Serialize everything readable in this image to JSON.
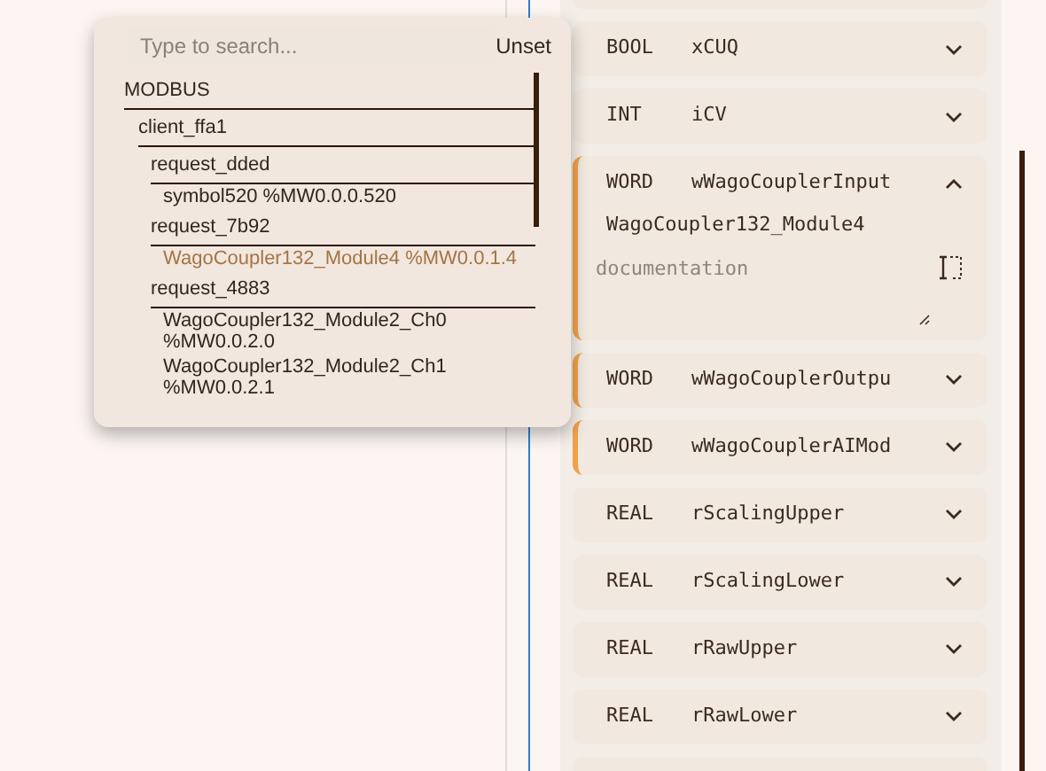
{
  "picker": {
    "search": {
      "placeholder": "Type to search..."
    },
    "unset_button": "Unset",
    "tree": [
      {
        "label": "MODBUS",
        "children": [
          {
            "label": "client_ffa1",
            "children": [
              {
                "label": "request_dded",
                "children": [
                  {
                    "label": "symbol520 %MW0.0.0.520",
                    "selected": false
                  }
                ]
              },
              {
                "label": "request_7b92",
                "children": [
                  {
                    "label": "WagoCoupler132_Module4 %MW0.0.1.4",
                    "selected": true
                  }
                ]
              },
              {
                "label": "request_4883",
                "children": [
                  {
                    "label": "WagoCoupler132_Module2_Ch0 %MW0.0.2.0",
                    "selected": false
                  },
                  {
                    "label": "WagoCoupler132_Module2_Ch1 %MW0.0.2.1",
                    "selected": false
                  }
                ]
              }
            ]
          }
        ]
      }
    ]
  },
  "variables": [
    {
      "type": "BOOL",
      "name": "xCUQ",
      "linked": false,
      "expanded": false
    },
    {
      "type": "INT",
      "name": "iCV",
      "linked": false,
      "expanded": false
    },
    {
      "type": "WORD",
      "name": "wWagoCouplerInput",
      "linked": true,
      "expanded": true,
      "mapping": "WagoCoupler132_Module4",
      "documentation": {
        "placeholder": "documentation"
      }
    },
    {
      "type": "WORD",
      "name": "wWagoCouplerOutpu",
      "linked": true,
      "expanded": false
    },
    {
      "type": "WORD",
      "name": "wWagoCouplerAIMod",
      "linked": true,
      "expanded": false
    },
    {
      "type": "REAL",
      "name": "rScalingUpper",
      "linked": false,
      "expanded": false
    },
    {
      "type": "REAL",
      "name": "rScalingLower",
      "linked": false,
      "expanded": false
    },
    {
      "type": "REAL",
      "name": "rRawUpper",
      "linked": false,
      "expanded": false
    },
    {
      "type": "REAL",
      "name": "rRawLower",
      "linked": false,
      "expanded": false
    }
  ]
}
